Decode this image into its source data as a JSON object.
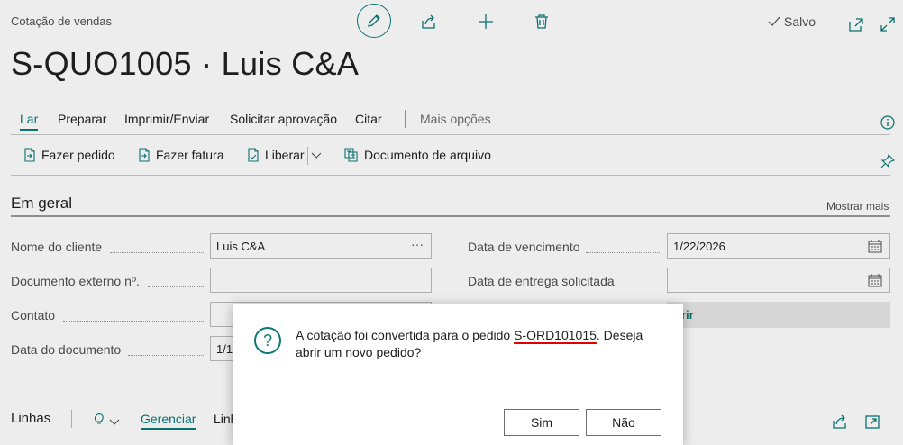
{
  "header": {
    "breadcrumb": "Cotação de vendas",
    "title": "S-QUO1005 · Luis C&A",
    "saved_label": "Salvo"
  },
  "nav": {
    "tabs": [
      "Lar",
      "Preparar",
      "Imprimir/Enviar",
      "Solicitar aprovação",
      "Citar"
    ],
    "more": "Mais opções"
  },
  "actions": {
    "make_order": "Fazer pedido",
    "make_invoice": "Fazer fatura",
    "release": "Liberar",
    "archive": "Documento de arquivo"
  },
  "general": {
    "title": "Em geral",
    "show_more": "Mostrar mais",
    "customer_name_label": "Nome do cliente",
    "customer_name_value": "Luis C&A",
    "external_doc_label": "Documento externo nº.",
    "external_doc_value": "",
    "contact_label": "Contato",
    "document_date_label": "Data do documento",
    "document_date_value": "1/1",
    "due_date_label": "Data de vencimento",
    "due_date_value": "1/22/2026",
    "requested_delivery_label": "Data de entrega solicitada",
    "requested_delivery_value": "",
    "partial_text": "rir"
  },
  "lines": {
    "title": "Linhas",
    "manage": "Gerenciar",
    "partial": "Linh"
  },
  "dialog": {
    "message_before": "A cotação foi convertida para o pedido ",
    "order_number": "S-ORD101015",
    "message_after": ". Deseja abrir um novo pedido?",
    "yes": "Sim",
    "no": "Não"
  },
  "colors": {
    "accent": "#0b7a78",
    "highlight_underline": "#e00000"
  }
}
